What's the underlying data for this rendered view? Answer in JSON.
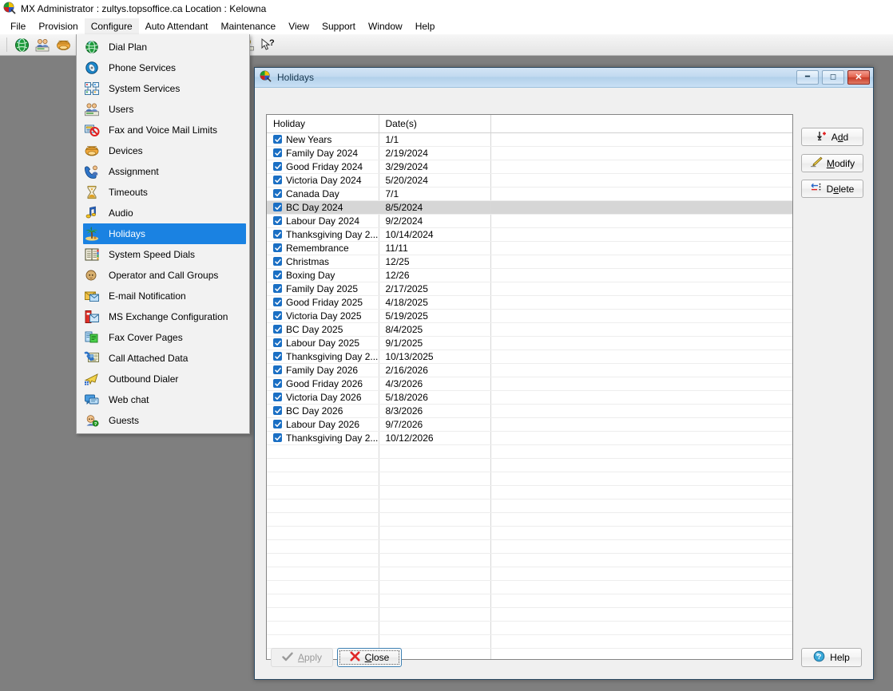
{
  "app": {
    "title": "MX Administrator : zultys.topsoffice.ca   Location : Kelowna",
    "icon": "mx-administrator-icon"
  },
  "menubar": {
    "items": [
      {
        "label": "File",
        "active": false
      },
      {
        "label": "Provision",
        "active": false
      },
      {
        "label": "Configure",
        "active": true
      },
      {
        "label": "Auto Attendant",
        "active": false
      },
      {
        "label": "Maintenance",
        "active": false
      },
      {
        "label": "View",
        "active": false
      },
      {
        "label": "Support",
        "active": false
      },
      {
        "label": "Window",
        "active": false
      },
      {
        "label": "Help",
        "active": false
      }
    ]
  },
  "toolbar": {
    "buttons": [
      {
        "icon": "globe-icon",
        "name": "dial-plan"
      },
      {
        "icon": "users-icon",
        "name": "users"
      },
      {
        "icon": "phone-orange-icon",
        "name": "devices"
      },
      {
        "icon": "phone-green-icon",
        "name": "phone-services"
      },
      {
        "icon": "call-assignment-icon",
        "name": "assignment"
      },
      {
        "icon": "call-attached-data-icon",
        "name": "call-attached-data"
      },
      {
        "icon": "auto-attendant-icon",
        "name": "auto-attendant"
      },
      {
        "icon": "operator-icon",
        "name": "operator-call-groups"
      },
      {
        "icon": "books-icon",
        "name": "address-book"
      },
      {
        "icon": "link-icon",
        "name": "link"
      },
      {
        "icon": "lightbulb-icon",
        "name": "tips"
      },
      {
        "icon": "help-cursor-icon",
        "name": "context-help"
      }
    ]
  },
  "configure_menu": {
    "items": [
      {
        "label": "Dial Plan",
        "icon": "globe-icon",
        "selected": false
      },
      {
        "label": "Phone Services",
        "icon": "phone-services-icon",
        "selected": false
      },
      {
        "label": "System Services",
        "icon": "system-services-icon",
        "selected": false
      },
      {
        "label": "Users",
        "icon": "users-icon",
        "selected": false
      },
      {
        "label": "Fax and Voice Mail Limits",
        "icon": "fax-limits-icon",
        "selected": false
      },
      {
        "label": "Devices",
        "icon": "devices-icon",
        "selected": false
      },
      {
        "label": "Assignment",
        "icon": "assignment-icon",
        "selected": false
      },
      {
        "label": "Timeouts",
        "icon": "hourglass-icon",
        "selected": false
      },
      {
        "label": "Audio",
        "icon": "music-note-icon",
        "selected": false
      },
      {
        "label": "Holidays",
        "icon": "palm-tree-icon",
        "selected": true
      },
      {
        "label": "System Speed Dials",
        "icon": "speed-dial-icon",
        "selected": false
      },
      {
        "label": "Operator and Call Groups",
        "icon": "operator-icon",
        "selected": false
      },
      {
        "label": "E-mail Notification",
        "icon": "email-icon",
        "selected": false
      },
      {
        "label": "MS Exchange Configuration",
        "icon": "exchange-icon",
        "selected": false
      },
      {
        "label": "Fax Cover Pages",
        "icon": "fax-cover-icon",
        "selected": false
      },
      {
        "label": "Call Attached Data",
        "icon": "call-data-icon",
        "selected": false
      },
      {
        "label": "Outbound Dialer",
        "icon": "outbound-dialer-icon",
        "selected": false
      },
      {
        "label": "Web chat",
        "icon": "web-chat-icon",
        "selected": false
      },
      {
        "label": "Guests",
        "icon": "guests-icon",
        "selected": false
      }
    ]
  },
  "dialog": {
    "title": "Holidays",
    "icon": "holidays-window-icon",
    "window_buttons": {
      "minimize": "minimize-button",
      "maximize": "maximize-button",
      "close": "close-button"
    },
    "table": {
      "columns": [
        "Holiday",
        "Date(s)",
        ""
      ],
      "rows": [
        {
          "checked": true,
          "name": "New Years",
          "date": "1/1",
          "selected": false
        },
        {
          "checked": true,
          "name": "Family Day 2024",
          "date": "2/19/2024",
          "selected": false
        },
        {
          "checked": true,
          "name": "Good Friday 2024",
          "date": "3/29/2024",
          "selected": false
        },
        {
          "checked": true,
          "name": "Victoria Day 2024",
          "date": "5/20/2024",
          "selected": false
        },
        {
          "checked": true,
          "name": "Canada Day",
          "date": "7/1",
          "selected": false
        },
        {
          "checked": true,
          "name": "BC Day 2024",
          "date": "8/5/2024",
          "selected": true
        },
        {
          "checked": true,
          "name": "Labour Day 2024",
          "date": "9/2/2024",
          "selected": false
        },
        {
          "checked": true,
          "name": "Thanksgiving Day 2...",
          "date": "10/14/2024",
          "selected": false
        },
        {
          "checked": true,
          "name": "Remembrance",
          "date": "11/11",
          "selected": false
        },
        {
          "checked": true,
          "name": "Christmas",
          "date": "12/25",
          "selected": false
        },
        {
          "checked": true,
          "name": "Boxing Day",
          "date": "12/26",
          "selected": false
        },
        {
          "checked": true,
          "name": "Family Day 2025",
          "date": "2/17/2025",
          "selected": false
        },
        {
          "checked": true,
          "name": "Good Friday 2025",
          "date": "4/18/2025",
          "selected": false
        },
        {
          "checked": true,
          "name": "Victoria Day 2025",
          "date": "5/19/2025",
          "selected": false
        },
        {
          "checked": true,
          "name": "BC Day 2025",
          "date": "8/4/2025",
          "selected": false
        },
        {
          "checked": true,
          "name": "Labour Day 2025",
          "date": "9/1/2025",
          "selected": false
        },
        {
          "checked": true,
          "name": "Thanksgiving Day 2...",
          "date": "10/13/2025",
          "selected": false
        },
        {
          "checked": true,
          "name": "Family Day 2026",
          "date": "2/16/2026",
          "selected": false
        },
        {
          "checked": true,
          "name": "Good Friday 2026",
          "date": "4/3/2026",
          "selected": false
        },
        {
          "checked": true,
          "name": "Victoria Day 2026",
          "date": "5/18/2026",
          "selected": false
        },
        {
          "checked": true,
          "name": "BC Day 2026",
          "date": "8/3/2026",
          "selected": false
        },
        {
          "checked": true,
          "name": "Labour Day 2026",
          "date": "9/7/2026",
          "selected": false
        },
        {
          "checked": true,
          "name": "Thanksgiving Day 2...",
          "date": "10/12/2026",
          "selected": false
        }
      ],
      "empty_row_count": 17
    },
    "side_buttons": [
      {
        "label": "Add",
        "accel": "d",
        "icon": "add-arrow-icon"
      },
      {
        "label": "Modify",
        "accel": "M",
        "icon": "pencil-icon"
      },
      {
        "label": "Delete",
        "accel": "e",
        "icon": "delete-icon"
      }
    ],
    "bottom_buttons": {
      "apply": {
        "label": "Apply",
        "accel": "A",
        "icon": "check-icon",
        "enabled": false
      },
      "close": {
        "label": "Close",
        "accel": "C",
        "icon": "red-x-icon",
        "enabled": true,
        "focused": true
      },
      "help": {
        "label": "Help",
        "icon": "help-icon",
        "enabled": true
      }
    }
  },
  "colors": {
    "desktop": "#7f7f7f",
    "selection_blue": "#1a82e2",
    "row_selected": "#d6d6d6",
    "checkbox_blue": "#1a6fc4",
    "dialog_title": "#c2daf0"
  }
}
